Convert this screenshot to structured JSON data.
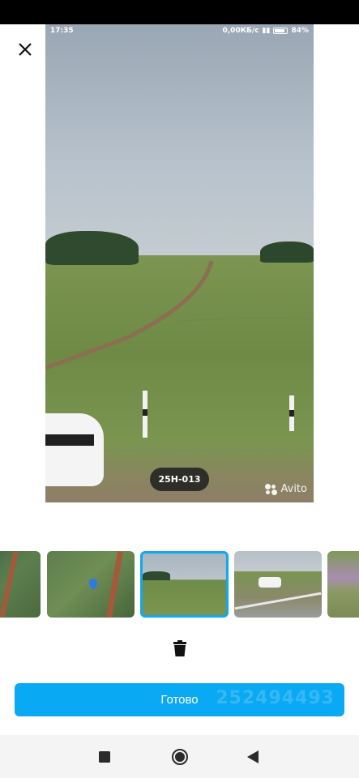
{
  "photo_viewer": {
    "status_bar": {
      "time": "17:35",
      "network_speed": "0,00КБ/с",
      "battery": "84%"
    },
    "plate_label": "25Н-013",
    "watermark_brand": "Avito",
    "accent_color": "#12a8f0"
  },
  "gallery": {
    "selected_index": 2,
    "thumbnail_count_visible": 5
  },
  "actions": {
    "done_label": "Готово",
    "done_watermark": "252494493",
    "done_color": "#0aa9f3"
  },
  "icons": {
    "close": "close-icon",
    "delete": "trash-icon",
    "nav_recents": "square-icon",
    "nav_home": "circle-icon",
    "nav_back": "triangle-back-icon"
  }
}
